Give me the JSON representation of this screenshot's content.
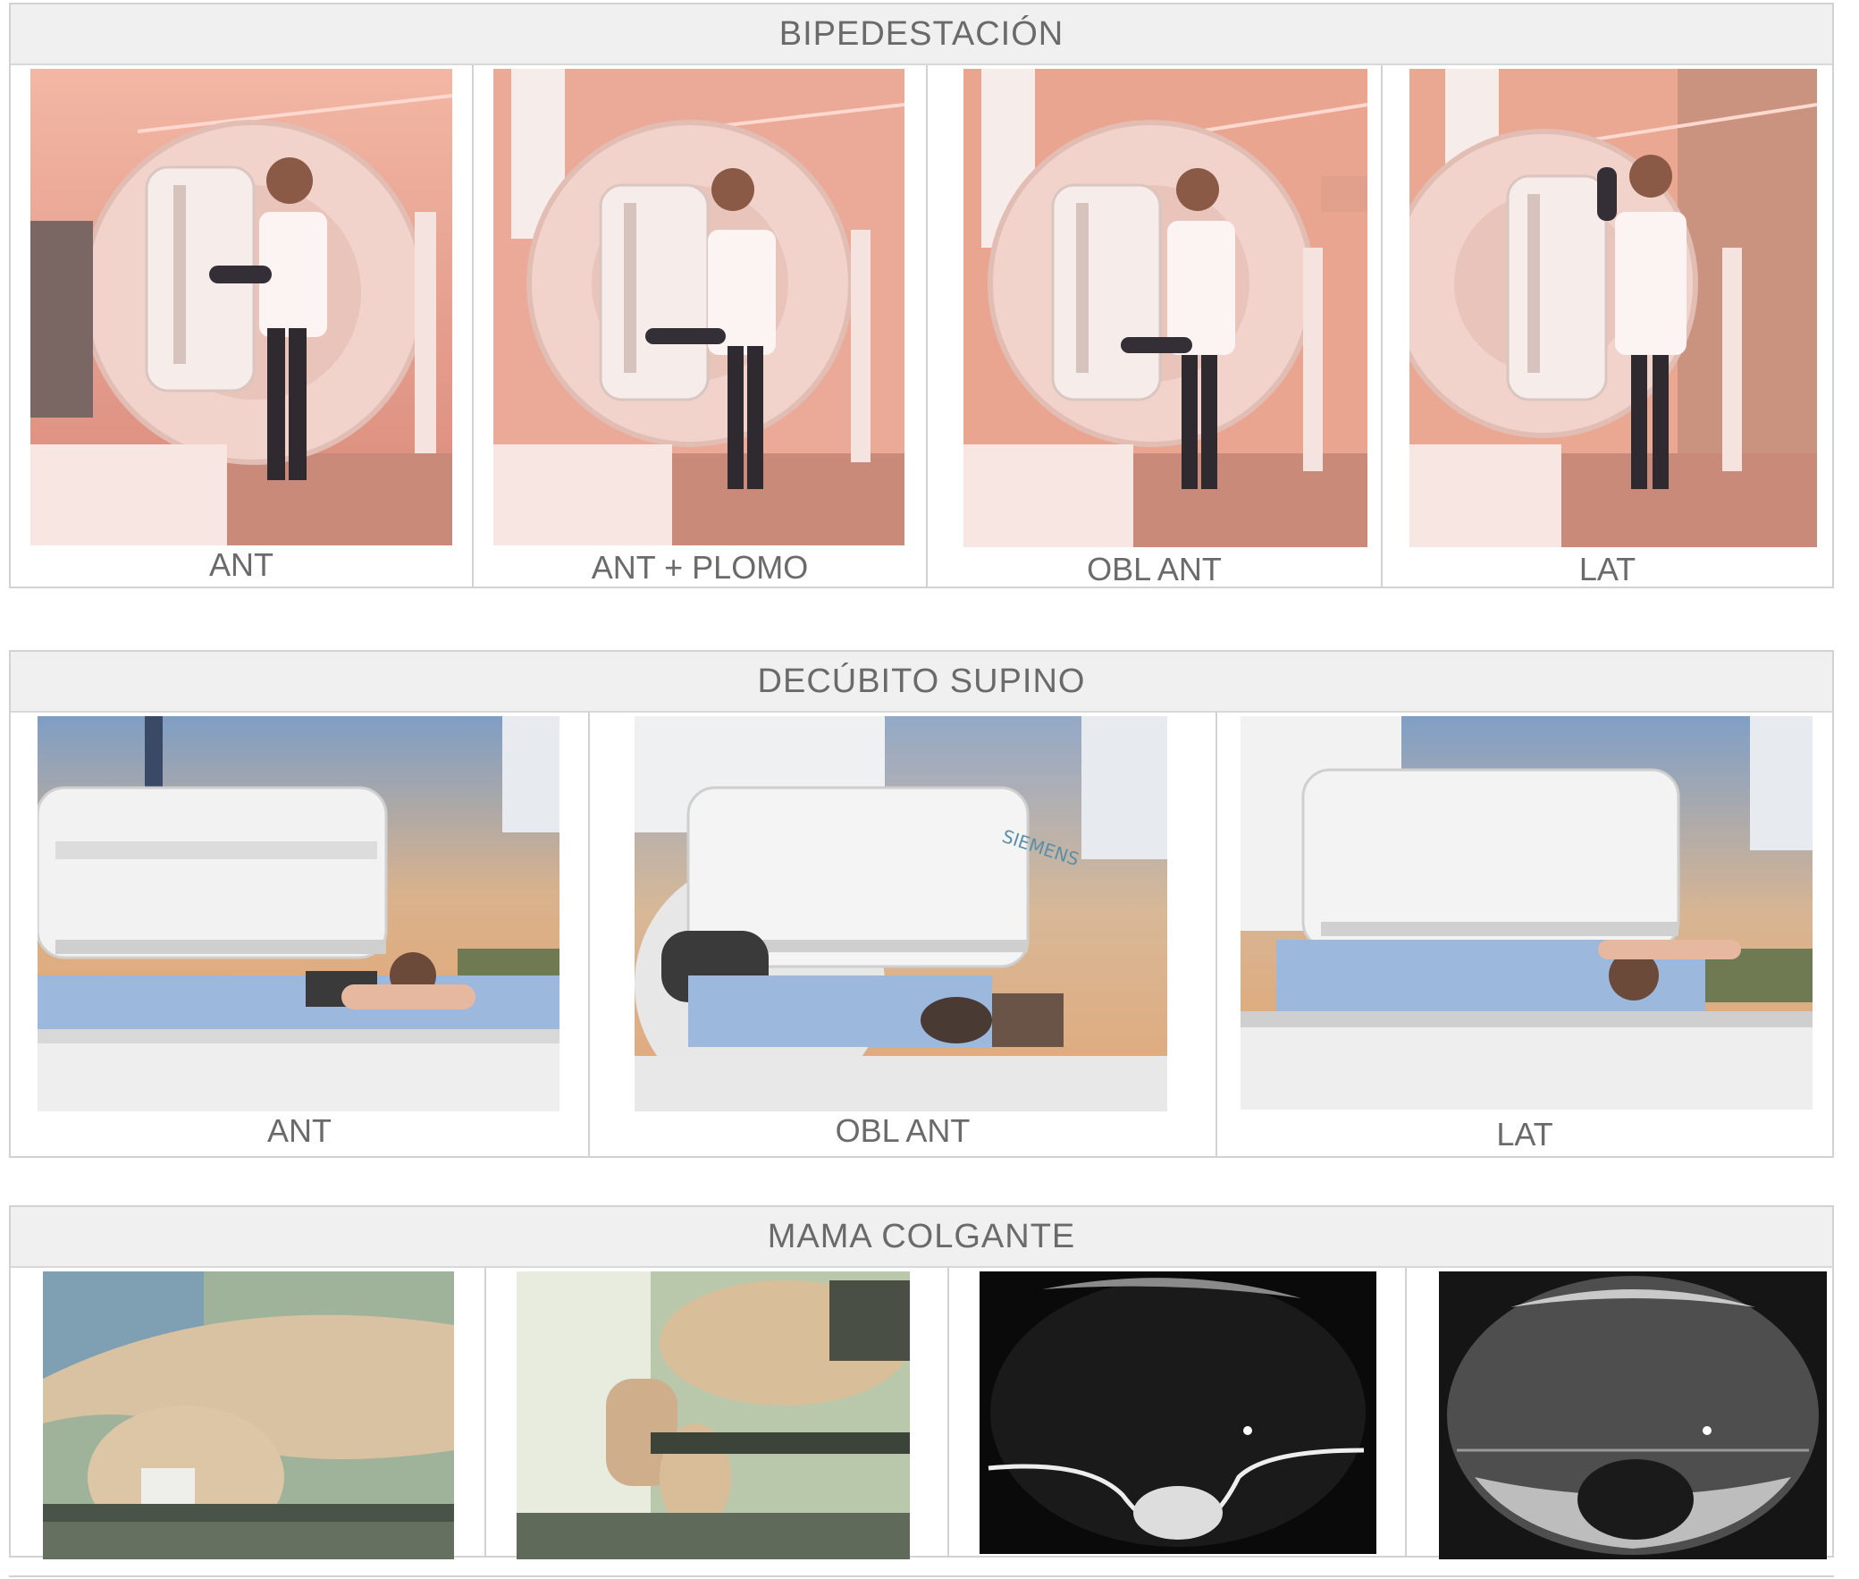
{
  "sections": [
    {
      "title": "BIPEDESTACIÓN",
      "panels": [
        {
          "caption": "ANT"
        },
        {
          "caption": "ANT + PLOMO"
        },
        {
          "caption": "OBL ANT"
        },
        {
          "caption": "LAT"
        }
      ]
    },
    {
      "title": "DECÚBITO SUPINO",
      "panels": [
        {
          "caption": "ANT"
        },
        {
          "caption": "OBL ANT"
        },
        {
          "caption": "LAT"
        }
      ]
    },
    {
      "title": "MAMA COLGANTE",
      "panels": []
    }
  ],
  "brand_text": "SIEMENS",
  "colors": {
    "room_tint": "#e9a58f",
    "header_bg": "#f0f0f0",
    "border": "#d2d2d2",
    "text": "#6a6a6a",
    "gown_blue": "#9cb8dd",
    "clinical_green": "#9fb39b"
  }
}
